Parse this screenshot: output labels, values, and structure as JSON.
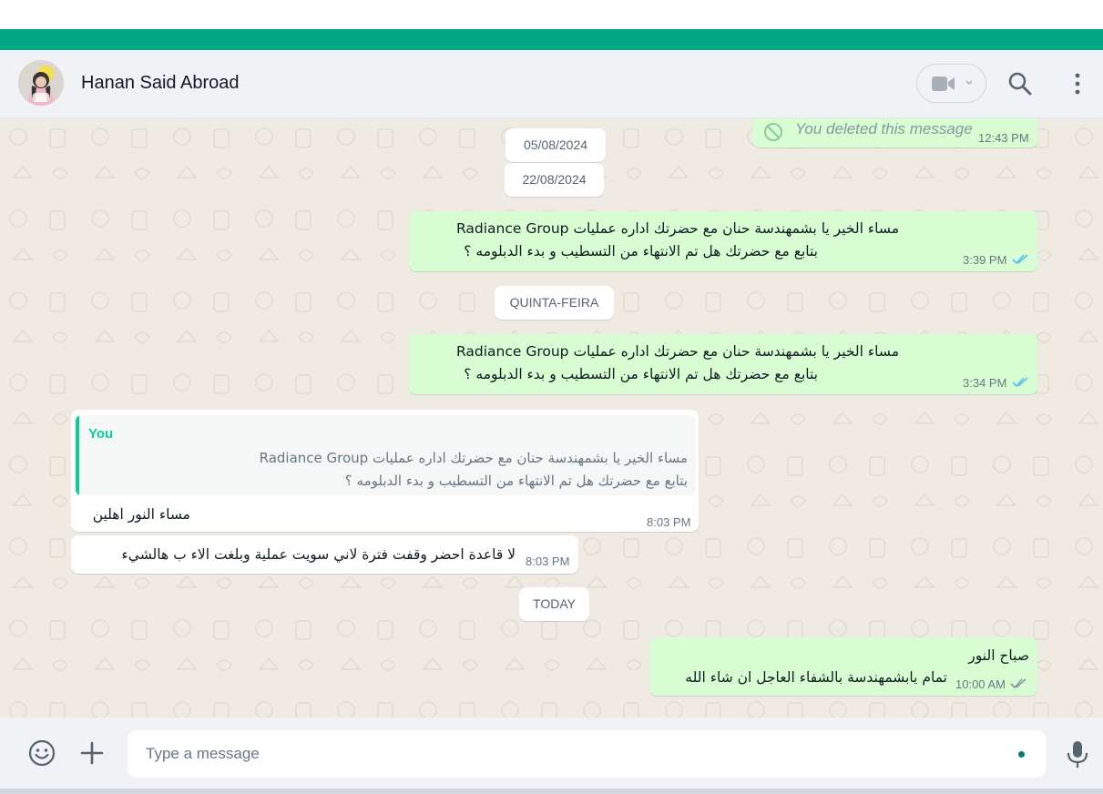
{
  "header": {
    "contact_name": "Hanan Said Abroad",
    "icons": [
      "video-call-icon",
      "chevron-down-icon",
      "search-icon",
      "menu-icon"
    ]
  },
  "chat": {
    "deleted": {
      "text": "You deleted this message",
      "time": "12:43 PM"
    },
    "date_1": "05/08/2024",
    "date_2": "22/08/2024",
    "msg_1": {
      "line1": "مساء الخير يا بشمهندسة حنان مع  حضرتك اداره عمليات Radiance Group",
      "line2": "بتابع مع حضرتك هل تم الانتهاء من التسطيب و بدء الدبلومه ؟",
      "time": "3:39 PM"
    },
    "date_3": "QUINTA-FEIRA",
    "msg_2": {
      "line1": "مساء الخير يا بشمهندسة حنان مع  حضرتك اداره عمليات Radiance Group",
      "line2": "بتابع مع حضرتك هل تم الانتهاء من التسطيب و بدء الدبلومه ؟",
      "time": "3:34 PM"
    },
    "reply": {
      "quote_author": "You",
      "quote_line1": "مساء الخير يا بشمهندسة حنان مع  حضرتك اداره عمليات Radiance Group",
      "quote_line2": "بتابع مع حضرتك هل تم الانتهاء من التسطيب و بدء الدبلومه ؟",
      "text": "مساء النور اهلين",
      "time": "8:03 PM"
    },
    "msg_3": {
      "text": "لا قاعدة احضر وقفت فترة لاني سويت عملية وبلغت الاء ب هالشيء",
      "time": "8:03 PM"
    },
    "date_4": "TODAY",
    "msg_4": {
      "line1": "صباح النور",
      "line2": "تمام يابشمهندسة بالشفاء العاجل ان شاء الله",
      "time": "10:00 AM"
    }
  },
  "footer": {
    "placeholder": "Type a message",
    "icons": [
      "emoji-icon",
      "plus-icon",
      "mic-icon"
    ]
  },
  "colors": {
    "accent": "#00a884",
    "outgoing_bubble": "#d9fdd3",
    "chat_background": "#efeae2",
    "read_ticks": "#53bdeb"
  }
}
